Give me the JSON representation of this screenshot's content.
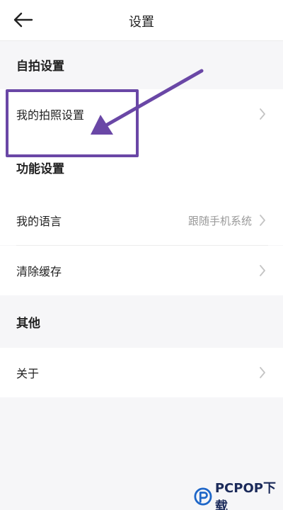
{
  "header": {
    "title": "设置",
    "back_icon": "arrow-left-icon"
  },
  "sections": [
    {
      "title": "自拍设置",
      "items": [
        {
          "label": "我的拍照设置",
          "value": ""
        }
      ]
    },
    {
      "title": "功能设置",
      "items": [
        {
          "label": "我的语言",
          "value": "跟随手机系统"
        },
        {
          "label": "清除缓存",
          "value": ""
        }
      ]
    },
    {
      "title": "其他",
      "items": [
        {
          "label": "关于",
          "value": ""
        }
      ]
    }
  ],
  "annotation": {
    "color": "#6a47a6"
  },
  "watermark": {
    "text": "PCPOP下载"
  },
  "colors": {
    "background": "#f6f6f8",
    "row_background": "#ffffff",
    "secondary_text": "#9a9a9a",
    "chevron": "#c4c4c4"
  }
}
